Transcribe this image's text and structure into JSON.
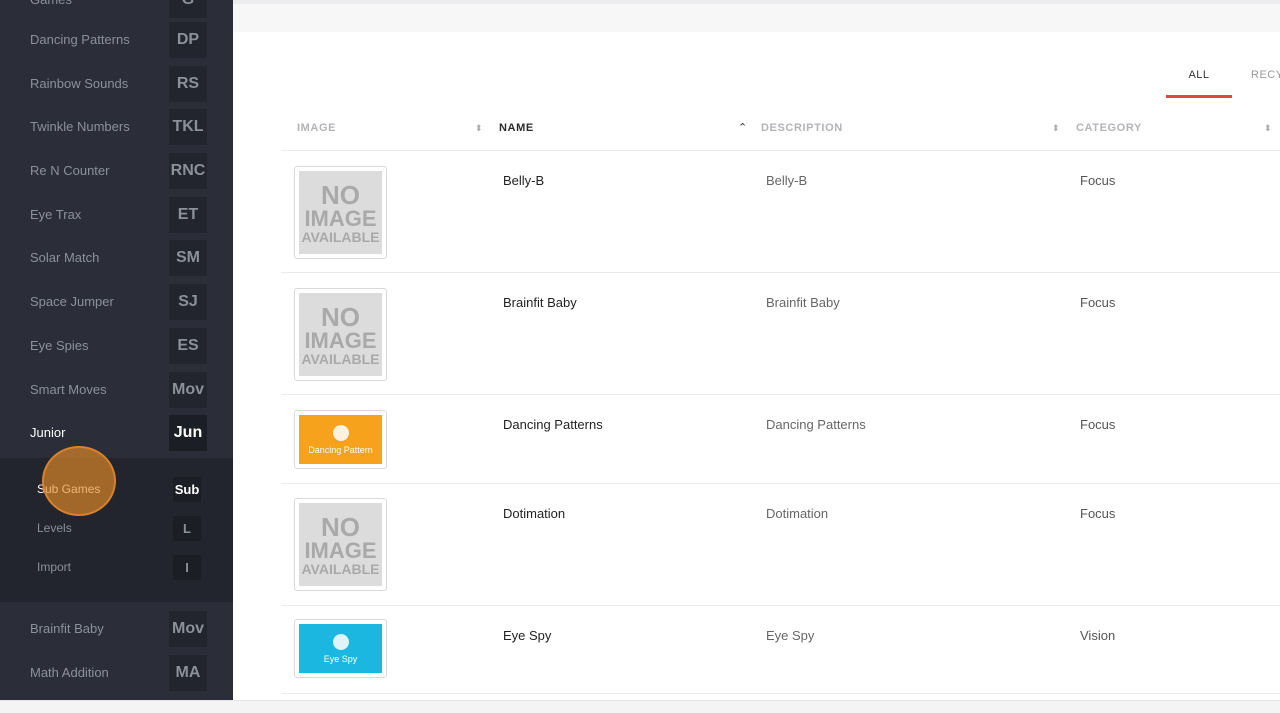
{
  "colors": {
    "sidebar_bg": "#2b2e38",
    "accent": "#e0483e",
    "cursor": "#d9822b"
  },
  "sidebar": {
    "items": [
      {
        "label": "Games",
        "abbr": "G"
      },
      {
        "label": "Dancing Patterns",
        "abbr": "DP"
      },
      {
        "label": "Rainbow Sounds",
        "abbr": "RS"
      },
      {
        "label": "Twinkle Numbers",
        "abbr": "TKL"
      },
      {
        "label": "Re N Counter",
        "abbr": "RNC"
      },
      {
        "label": "Eye Trax",
        "abbr": "ET"
      },
      {
        "label": "Solar Match",
        "abbr": "SM"
      },
      {
        "label": "Space Jumper",
        "abbr": "SJ"
      },
      {
        "label": "Eye Spies",
        "abbr": "ES"
      },
      {
        "label": "Smart Moves",
        "abbr": "Mov"
      },
      {
        "label": "Junior",
        "abbr": "Jun"
      }
    ],
    "submenu": [
      {
        "label": "Sub Games",
        "abbr": "Sub"
      },
      {
        "label": "Levels",
        "abbr": "L"
      },
      {
        "label": "Import",
        "abbr": "I"
      }
    ],
    "lower_items": [
      {
        "label": "Brainfit Baby",
        "abbr": "Mov"
      },
      {
        "label": "Math Addition",
        "abbr": "MA"
      }
    ]
  },
  "tabs": {
    "all": "ALL",
    "recycle": "RECY"
  },
  "table": {
    "headers": {
      "image": "IMAGE",
      "name": "NAME",
      "description": "DESCRIPTION",
      "category": "CATEGORY"
    },
    "no_image": {
      "line1": "NO",
      "line2": "IMAGE",
      "line3": "AVAILABLE"
    },
    "rows": [
      {
        "name": "Belly-B",
        "description": "Belly-B",
        "category": "Focus",
        "image": "none"
      },
      {
        "name": "Brainfit Baby",
        "description": "Brainfit Baby",
        "category": "Focus",
        "image": "none"
      },
      {
        "name": "Dancing Patterns",
        "description": "Dancing Patterns",
        "category": "Focus",
        "image": "Dancing Pattern",
        "image_color": "#f6a21c"
      },
      {
        "name": "Dotimation",
        "description": "Dotimation",
        "category": "Focus",
        "image": "none"
      },
      {
        "name": "Eye Spy",
        "description": "Eye Spy",
        "category": "Vision",
        "image": "Eye Spy",
        "image_color": "#1bb7e0"
      }
    ]
  }
}
